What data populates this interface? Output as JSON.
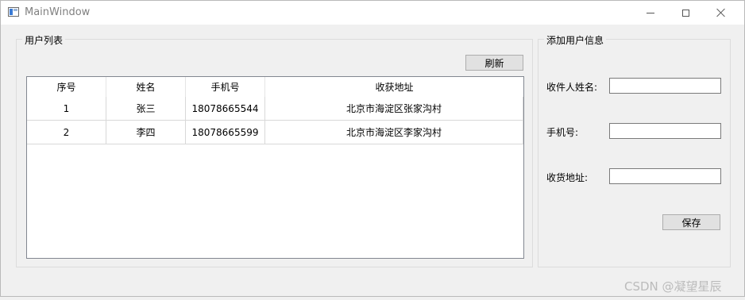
{
  "window": {
    "title": "MainWindow",
    "icons": {
      "app": "app-window-icon",
      "minimize": "minimize-icon",
      "maximize": "maximize-icon",
      "close": "close-icon"
    }
  },
  "user_list": {
    "group_title": "用户列表",
    "refresh_label": "刷新",
    "columns": [
      "序号",
      "姓名",
      "手机号",
      "收获地址"
    ],
    "rows": [
      [
        "1",
        "张三",
        "18078665544",
        "北京市海淀区张家沟村"
      ],
      [
        "2",
        "李四",
        "18078665599",
        "北京市海淀区李家沟村"
      ]
    ]
  },
  "add_user": {
    "group_title": "添加用户信息",
    "name_label": "收件人姓名:",
    "name_value": "",
    "phone_label": "手机号:",
    "phone_value": "",
    "address_label": "收货地址:",
    "address_value": "",
    "save_label": "保存"
  },
  "watermark": "CSDN @凝望星辰"
}
